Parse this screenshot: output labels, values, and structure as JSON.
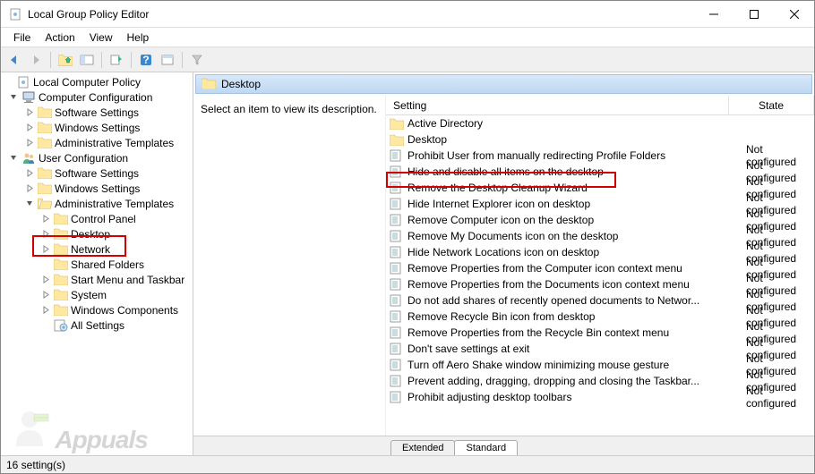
{
  "window": {
    "title": "Local Group Policy Editor"
  },
  "menubar": [
    "File",
    "Action",
    "View",
    "Help"
  ],
  "tree": {
    "root": "Local Computer Policy",
    "computer_config": "Computer Configuration",
    "cc_software": "Software Settings",
    "cc_windows": "Windows Settings",
    "cc_admin": "Administrative Templates",
    "user_config": "User Configuration",
    "uc_software": "Software Settings",
    "uc_windows": "Windows Settings",
    "uc_admin": "Administrative Templates",
    "control_panel": "Control Panel",
    "desktop": "Desktop",
    "network": "Network",
    "shared_folders": "Shared Folders",
    "start_taskbar": "Start Menu and Taskbar",
    "system": "System",
    "win_components": "Windows Components",
    "all_settings": "All Settings"
  },
  "content": {
    "header": "Desktop",
    "desc_prompt": "Select an item to view its description.",
    "col_setting": "Setting",
    "col_state": "State"
  },
  "settings": [
    {
      "type": "folder",
      "name": "Active Directory",
      "state": ""
    },
    {
      "type": "folder",
      "name": "Desktop",
      "state": ""
    },
    {
      "type": "policy",
      "name": "Prohibit User from manually redirecting Profile Folders",
      "state": "Not configured"
    },
    {
      "type": "policy",
      "name": "Hide and disable all items on the desktop",
      "state": "Not configured",
      "highlight": true
    },
    {
      "type": "policy",
      "name": "Remove the Desktop Cleanup Wizard",
      "state": "Not configured"
    },
    {
      "type": "policy",
      "name": "Hide Internet Explorer icon on desktop",
      "state": "Not configured"
    },
    {
      "type": "policy",
      "name": "Remove Computer icon on the desktop",
      "state": "Not configured"
    },
    {
      "type": "policy",
      "name": "Remove My Documents icon on the desktop",
      "state": "Not configured"
    },
    {
      "type": "policy",
      "name": "Hide Network Locations icon on desktop",
      "state": "Not configured"
    },
    {
      "type": "policy",
      "name": "Remove Properties from the Computer icon context menu",
      "state": "Not configured"
    },
    {
      "type": "policy",
      "name": "Remove Properties from the Documents icon context menu",
      "state": "Not configured"
    },
    {
      "type": "policy",
      "name": "Do not add shares of recently opened documents to Networ...",
      "state": "Not configured"
    },
    {
      "type": "policy",
      "name": "Remove Recycle Bin icon from desktop",
      "state": "Not configured"
    },
    {
      "type": "policy",
      "name": "Remove Properties from the Recycle Bin context menu",
      "state": "Not configured"
    },
    {
      "type": "policy",
      "name": "Don't save settings at exit",
      "state": "Not configured"
    },
    {
      "type": "policy",
      "name": "Turn off Aero Shake window minimizing mouse gesture",
      "state": "Not configured"
    },
    {
      "type": "policy",
      "name": "Prevent adding, dragging, dropping and closing the Taskbar...",
      "state": "Not configured"
    },
    {
      "type": "policy",
      "name": "Prohibit adjusting desktop toolbars",
      "state": "Not configured"
    }
  ],
  "tabs": {
    "extended": "Extended",
    "standard": "Standard"
  },
  "statusbar": "16 setting(s)",
  "watermark": "Appuals"
}
